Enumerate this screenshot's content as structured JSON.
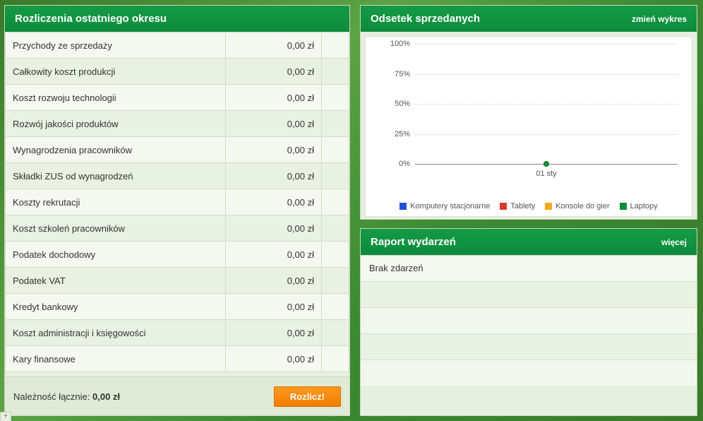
{
  "settlements": {
    "title": "Rozliczenia ostatniego okresu",
    "rows": [
      {
        "label": "Przychody ze sprzedaży",
        "value": "0,00 zł"
      },
      {
        "label": "Całkowity koszt produkcji",
        "value": "0,00 zł"
      },
      {
        "label": "Koszt rozwoju technologii",
        "value": "0,00 zł"
      },
      {
        "label": "Rozwój jakości produktów",
        "value": "0,00 zł"
      },
      {
        "label": "Wynagrodzenia pracowników",
        "value": "0,00 zł"
      },
      {
        "label": "Składki ZUS od wynagrodzeń",
        "value": "0,00 zł"
      },
      {
        "label": "Koszty rekrutacji",
        "value": "0,00 zł"
      },
      {
        "label": "Koszt szkoleń pracowników",
        "value": "0,00 zł"
      },
      {
        "label": "Podatek dochodowy",
        "value": "0,00 zł"
      },
      {
        "label": "Podatek VAT",
        "value": "0,00 zł"
      },
      {
        "label": "Kredyt bankowy",
        "value": "0,00 zł"
      },
      {
        "label": "Koszt administracji i księgowości",
        "value": "0,00 zł"
      },
      {
        "label": "Kary finansowe",
        "value": "0,00 zł"
      }
    ],
    "total_label": "Należność łącznie:",
    "total_value": "0,00 zł",
    "settle_button": "Rozlicz!"
  },
  "chart": {
    "title": "Odsetek sprzedanych",
    "change_link": "zmień wykres"
  },
  "chart_data": {
    "type": "line",
    "ylabel": "",
    "xlabel": "",
    "ylim": [
      0,
      100
    ],
    "y_ticks": [
      "0%",
      "25%",
      "50%",
      "75%",
      "100%"
    ],
    "categories": [
      "01 sty"
    ],
    "series": [
      {
        "name": "Komputery stacjonarne",
        "color": "#1f4fd6",
        "values": [
          0
        ]
      },
      {
        "name": "Tablety",
        "color": "#d63a2f",
        "values": [
          0
        ]
      },
      {
        "name": "Konsole do gier",
        "color": "#f2a71d",
        "values": [
          0
        ]
      },
      {
        "name": "Laptopy",
        "color": "#0c8b3c",
        "values": [
          0
        ]
      }
    ]
  },
  "events": {
    "title": "Raport wydarzeń",
    "more_link": "więcej",
    "items": [
      "Brak zdarzeń"
    ],
    "empty_rows": 4
  },
  "plus_tab": "+"
}
